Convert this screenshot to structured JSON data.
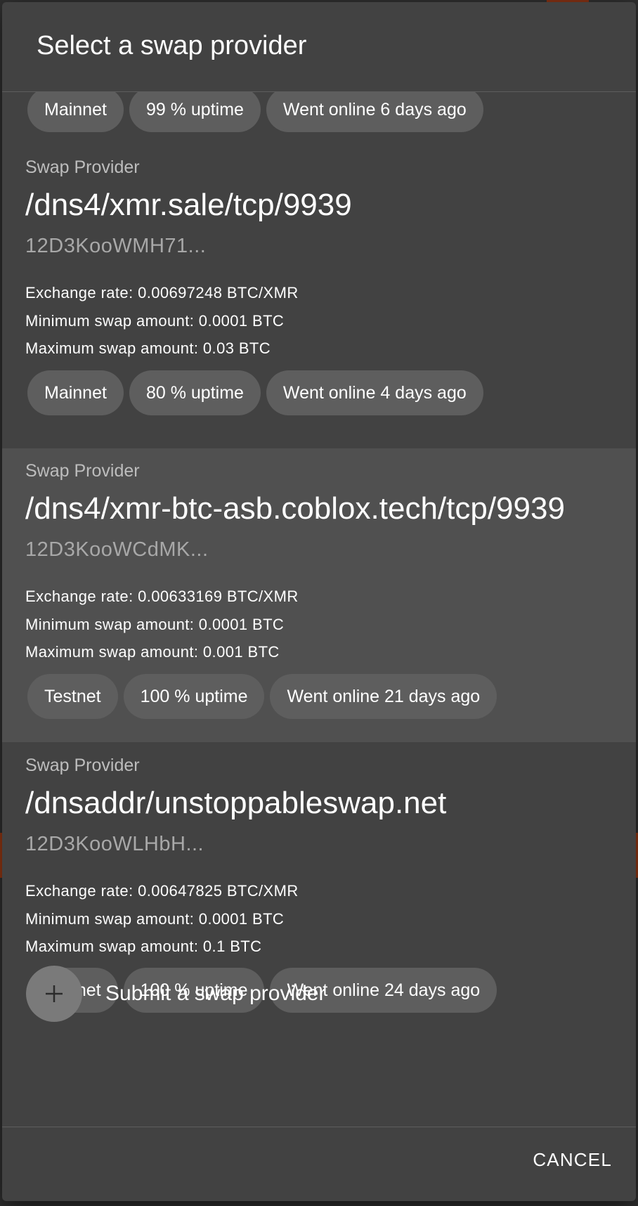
{
  "dialog": {
    "title": "Select a swap provider",
    "cancel_label": "CANCEL"
  },
  "top_partial_chips": [
    "Mainnet",
    "99 % uptime",
    "Went online 6 days ago"
  ],
  "providers": [
    {
      "overline": "Swap Provider",
      "address": "/dns4/xmr.sale/tcp/9939",
      "peer_id": "12D3KooWMH71...",
      "exchange_rate": "Exchange rate: 0.00697248 BTC/XMR",
      "min_amount": "Minimum swap amount: 0.0001 BTC",
      "max_amount": "Maximum swap amount: 0.03 BTC",
      "chips": [
        "Mainnet",
        "80 % uptime",
        "Went online 4 days ago"
      ],
      "selected": false
    },
    {
      "overline": "Swap Provider",
      "address": "/dns4/xmr-btc-asb.coblox.tech/tcp/9939",
      "peer_id": "12D3KooWCdMK...",
      "exchange_rate": "Exchange rate: 0.00633169 BTC/XMR",
      "min_amount": "Minimum swap amount: 0.0001 BTC",
      "max_amount": "Maximum swap amount: 0.001 BTC",
      "chips": [
        "Testnet",
        "100 % uptime",
        "Went online 21 days ago"
      ],
      "selected": true
    },
    {
      "overline": "Swap Provider",
      "address": "/dnsaddr/unstoppableswap.net",
      "peer_id": "12D3KooWLHbH...",
      "exchange_rate": "Exchange rate: 0.00647825 BTC/XMR",
      "min_amount": "Minimum swap amount: 0.0001 BTC",
      "max_amount": "Maximum swap amount: 0.1 BTC",
      "chips": [
        "Testnet",
        "100 % uptime",
        "Went online 24 days ago"
      ],
      "selected": false
    }
  ],
  "submit": {
    "label": "Submit a swap provider",
    "icon": "plus-icon"
  },
  "colors": {
    "dialog_bg": "#424242",
    "selected_bg": "#505050",
    "chip_bg": "#5e5e5e",
    "accent": "#9a3a14"
  }
}
